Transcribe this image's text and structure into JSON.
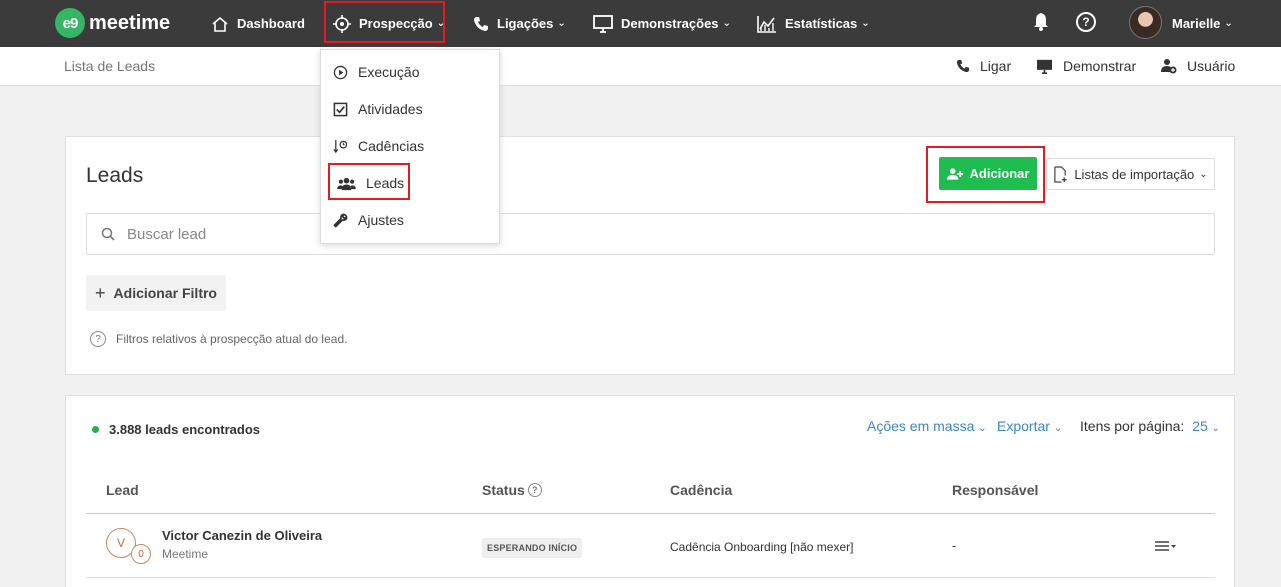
{
  "brand": {
    "logo_mark": "e9",
    "name": "meetime"
  },
  "nav": {
    "dashboard": "Dashboard",
    "prospeccao": "Prospecção",
    "ligacoes": "Ligações",
    "demonstracoes": "Demonstrações",
    "estatisticas": "Estatísticas",
    "user_name": "Marielle"
  },
  "subheader": {
    "breadcrumb": "Lista de Leads",
    "ligar": "Ligar",
    "demonstrar": "Demonstrar",
    "usuario": "Usuário"
  },
  "dropdown": {
    "items": [
      "Execução",
      "Atividades",
      "Cadências",
      "Leads",
      "Ajustes"
    ]
  },
  "leads_card": {
    "title": "Leads",
    "add_button": "Adicionar",
    "import_button": "Listas de importação",
    "search_placeholder": "Buscar lead",
    "add_filter": "Adicionar Filtro",
    "filter_note": "Filtros relativos à prospecção atual do lead."
  },
  "results": {
    "count_text": "3.888 leads encontrados",
    "bulk_actions": "Ações em massa",
    "export": "Exportar",
    "per_page_label": "Itens por página:",
    "per_page_value": "25",
    "columns": [
      "Lead",
      "Status",
      "Cadência",
      "Responsável"
    ],
    "rows": [
      {
        "initial": "V",
        "badge": "0",
        "name": "Victor Canezin de Oliveira",
        "company": "Meetime",
        "status": "ESPERANDO INÍCIO",
        "cadencia": "Cadência Onboarding [não mexer]",
        "responsavel": "-"
      }
    ]
  },
  "colors": {
    "nav_bg": "#3b3b3b",
    "accent_green": "#1fbd50",
    "link_blue": "#3a86c8",
    "highlight_red": "#e31b23"
  }
}
